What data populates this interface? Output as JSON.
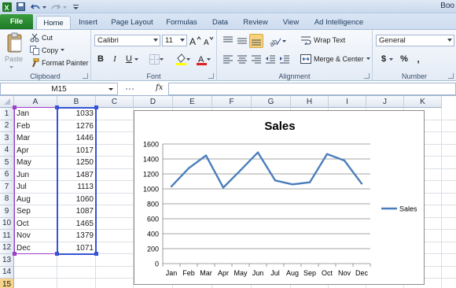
{
  "window": {
    "title": "Boo"
  },
  "tabs": [
    "File",
    "Home",
    "Insert",
    "Page Layout",
    "Formulas",
    "Data",
    "Review",
    "View",
    "Ad Intelligence"
  ],
  "clipboard": {
    "paste": "Paste",
    "cut": "Cut",
    "copy": "Copy",
    "format_painter": "Format Painter",
    "label": "Clipboard"
  },
  "font": {
    "name": "Calibri",
    "size": "11",
    "label": "Font"
  },
  "alignment": {
    "wrap_text": "Wrap Text",
    "merge_center": "Merge & Center",
    "label": "Alignment"
  },
  "number": {
    "format": "General",
    "currency": "$",
    "percent": "%",
    "comma": ",",
    "label": "Number"
  },
  "formula_bar": {
    "name_box": "M15",
    "fx": "fx",
    "value": ""
  },
  "columns": [
    "A",
    "B",
    "C",
    "D",
    "E",
    "F",
    "G",
    "H",
    "I",
    "J",
    "K"
  ],
  "rows": [
    "1",
    "2",
    "3",
    "4",
    "5",
    "6",
    "7",
    "8",
    "9",
    "10",
    "11",
    "12",
    "13",
    "14",
    "15"
  ],
  "table": [
    {
      "month": "Jan",
      "value": "1033"
    },
    {
      "month": "Feb",
      "value": "1276"
    },
    {
      "month": "Mar",
      "value": "1446"
    },
    {
      "month": "Apr",
      "value": "1017"
    },
    {
      "month": "May",
      "value": "1250"
    },
    {
      "month": "Jun",
      "value": "1487"
    },
    {
      "month": "Jul",
      "value": "1113"
    },
    {
      "month": "Aug",
      "value": "1060"
    },
    {
      "month": "Sep",
      "value": "1087"
    },
    {
      "month": "Oct",
      "value": "1465"
    },
    {
      "month": "Nov",
      "value": "1379"
    },
    {
      "month": "Dec",
      "value": "1071"
    }
  ],
  "colors": {
    "line": "#4a7ebb",
    "file_tab": "#2a8a30",
    "select_purple": "#9d3dc9",
    "select_blue": "#3553d6",
    "row_highlight": "#f7d48a"
  },
  "chart_data": {
    "type": "line",
    "title": "Sales",
    "categories": [
      "Jan",
      "Feb",
      "Mar",
      "Apr",
      "May",
      "Jun",
      "Jul",
      "Aug",
      "Sep",
      "Oct",
      "Nov",
      "Dec"
    ],
    "series": [
      {
        "name": "Sales",
        "values": [
          1033,
          1276,
          1446,
          1017,
          1250,
          1487,
          1113,
          1060,
          1087,
          1465,
          1379,
          1071
        ]
      }
    ],
    "ylim": [
      0,
      1600
    ],
    "yticks": [
      0,
      200,
      400,
      600,
      800,
      1000,
      1200,
      1400,
      1600
    ],
    "grid": true,
    "legend": "right"
  }
}
